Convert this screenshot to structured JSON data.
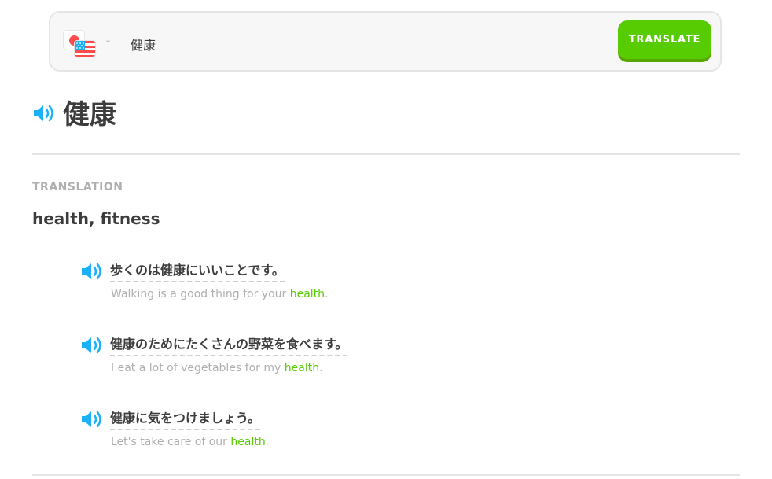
{
  "search": {
    "value": "健康",
    "translate_label": "TRANSLATE",
    "language_flags": [
      "japan-flag-icon",
      "us-flag-icon"
    ]
  },
  "entry": {
    "headword": "健康",
    "section_label": "TRANSLATION",
    "meaning": "health, fitness"
  },
  "examples": [
    {
      "japanese": "歩くのは健康にいいことです。",
      "english_before": "Walking is a good thing for your ",
      "english_highlight": "health",
      "english_after": "."
    },
    {
      "japanese": "健康のためにたくさんの野菜を食べます。",
      "english_before": "I eat a lot of vegetables for my ",
      "english_highlight": "health",
      "english_after": "."
    },
    {
      "japanese": "健康に気をつけましょう。",
      "english_before": "Let's take care of our ",
      "english_highlight": "health",
      "english_after": "."
    }
  ],
  "colors": {
    "accent_green": "#58cc02",
    "speaker_blue": "#1cb0f6",
    "muted_text": "#afafaf",
    "main_text": "#3c3c3c"
  }
}
